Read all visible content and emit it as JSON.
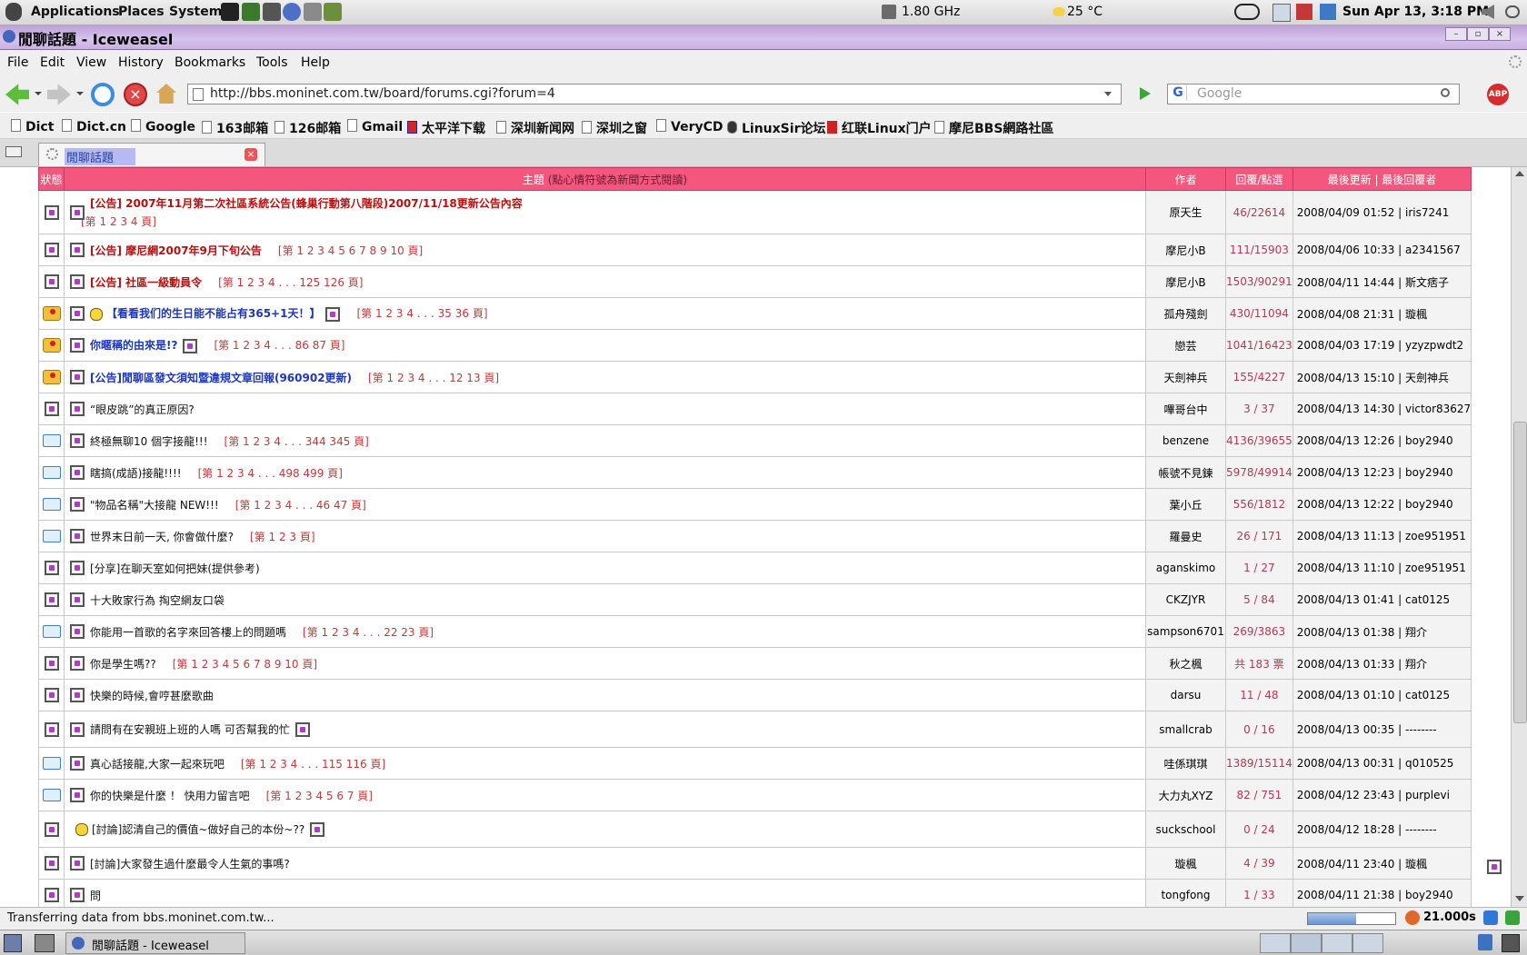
{
  "top_panel": {
    "menus": [
      "Applications",
      "Places",
      "System"
    ],
    "cpu": "1.80 GHz",
    "weather": "25 °C",
    "clock": "Sun Apr 13,  3:18 PM"
  },
  "window": {
    "title": "閒聊話題 - Iceweasel"
  },
  "menubar": [
    "File",
    "Edit",
    "View",
    "History",
    "Bookmarks",
    "Tools",
    "Help"
  ],
  "navbar": {
    "url": "http://bbs.moninet.com.tw/board/forums.cgi?forum=4",
    "search_placeholder": "Google",
    "search_engine_letter": "G",
    "adblock": "ABP"
  },
  "bookmarks": [
    "Dict",
    "Dict.cn",
    "Google",
    "163邮箱",
    "126邮箱",
    "Gmail",
    "太平洋下载",
    "深圳新闻网",
    "深圳之窗",
    "VeryCD",
    "LinuxSir论坛",
    "红联Linux门户",
    "摩尼BBS網路社區"
  ],
  "tab": {
    "label": "閒聊話題"
  },
  "table": {
    "headers": {
      "status": "狀態",
      "topic": "主題",
      "topic_note": "(點心情符號為新聞方式閱讀)",
      "author": "作者",
      "replies": "回覆/點選",
      "last": "最後更新 | 最後回覆者"
    },
    "rows": [
      {
        "status": "normal",
        "title": "[公告] 2007年11月第二次社區系統公告(蜂巢行動第八階段)2007/11/18更新公告內容",
        "style": "red",
        "pages": "[第 1 2 3 4 頁]",
        "pages_wrap": true,
        "author": "原天生",
        "replies": "46/22614",
        "last": "2008/04/09 01:52 | iris7241"
      },
      {
        "status": "normal",
        "title": "[公告] 摩尼網2007年9月下旬公告",
        "style": "red",
        "pages": "[第 1 2 3 4 5 6 7 8 9 10 頁]",
        "author": "摩尼小B",
        "replies": "111/15903",
        "last": "2008/04/06 10:33 | a2341567"
      },
      {
        "status": "normal",
        "title": "[公告] 社區一級動員令",
        "style": "red",
        "pages": "[第 1 2 3 4 . . . 125 126 頁]",
        "author": "摩尼小B",
        "replies": "1503/90291",
        "last": "2008/04/11 14:44 | 斯文痞子"
      },
      {
        "status": "hot",
        "title": "【看看我们的生日能不能占有365+1天！】",
        "style": "blue",
        "smiley": true,
        "trail_icon": true,
        "pages": "[第 1 2 3 4 . . . 35 36 頁]",
        "author": "孤舟殘劍",
        "replies": "430/11094",
        "last": "2008/04/08 21:31 | 璇楓"
      },
      {
        "status": "hot",
        "title": "你暱稱的由來是!?",
        "style": "blue",
        "trail_icon": true,
        "pages": "[第 1 2 3 4 . . . 86 87 頁]",
        "author": "戀芸",
        "replies": "1041/16423",
        "last": "2008/04/03 17:19 | yzyzpwdt2"
      },
      {
        "status": "hot",
        "title": "[公告]閒聊區發文須知暨違規文章回報(960902更新)",
        "style": "blue",
        "pages": "[第 1 2 3 4 . . . 12 13 頁]",
        "author": "天劍神兵",
        "replies": "155/4227",
        "last": "2008/04/13 15:10 | 天劍神兵"
      },
      {
        "status": "normal",
        "title": "“眼皮跳”的真正原因?",
        "style": "plain",
        "pages": "",
        "author": "嗶哥台中",
        "replies": "3 / 37",
        "last": "2008/04/13 14:30 | victor83627"
      },
      {
        "status": "new",
        "title": "終極無聊10 個字接龍!!!",
        "style": "plain",
        "pages": "[第 1 2 3 4 . . . 344 345 頁]",
        "author": "benzene",
        "replies": "4136/39655",
        "last": "2008/04/13 12:26 | boy2940"
      },
      {
        "status": "new",
        "title": "瞎搞(成語)接龍!!!!",
        "style": "plain",
        "pages": "[第 1 2 3 4 . . . 498 499 頁]",
        "author": "帳號不見鍊",
        "replies": "5978/49914",
        "last": "2008/04/13 12:23 | boy2940"
      },
      {
        "status": "new",
        "title": "\"物品名稱\"大接龍 NEW!!!",
        "style": "plain",
        "pages": "[第 1 2 3 4 . . . 46 47 頁]",
        "author": "葉小丘",
        "replies": "556/1812",
        "last": "2008/04/13 12:22 | boy2940"
      },
      {
        "status": "new",
        "title": "世界末日前一天, 你會做什麼?",
        "style": "plain",
        "pages": "[第 1 2 3 頁]",
        "author": "羅曼史",
        "replies": "26 / 171",
        "last": "2008/04/13 11:13 | zoe951951"
      },
      {
        "status": "normal",
        "title": "[分享]在聊天室如何把妹(提供參考)",
        "style": "plain",
        "pages": "",
        "author": "aganskimo",
        "replies": "1 / 27",
        "last": "2008/04/13 11:10 | zoe951951"
      },
      {
        "status": "normal",
        "title": "十大敗家行為 掏空網友口袋",
        "style": "plain",
        "pages": "",
        "author": "CKZJYR",
        "replies": "5 / 84",
        "last": "2008/04/13 01:41 | cat0125"
      },
      {
        "status": "new",
        "title": "你能用一首歌的名字來回答樓上的問題嗎",
        "style": "plain",
        "pages": "[第 1 2 3 4 . . . 22 23 頁]",
        "author": "sampson6701",
        "replies": "269/3863",
        "last": "2008/04/13 01:38 | 翔介"
      },
      {
        "status": "normal",
        "title": "你是學生嗎??",
        "style": "plain",
        "pages": "[第 1 2 3 4 5 6 7 8 9 10 頁]",
        "author": "秋之楓",
        "replies": "共 183 票",
        "last": "2008/04/13 01:33 | 翔介"
      },
      {
        "status": "normal",
        "title": "快樂的時候,會哼甚麼歌曲",
        "style": "plain",
        "pages": "",
        "author": "darsu",
        "replies": "11 / 48",
        "last": "2008/04/13 01:10 | cat0125"
      },
      {
        "status": "normal",
        "title": "請問有在安親班上班的人嗎   可否幫我的忙",
        "style": "plain",
        "trail_icon": true,
        "pages": "",
        "author": "smallcrab",
        "replies": "0 / 16",
        "last": "2008/04/13 00:35 | --------"
      },
      {
        "status": "new",
        "title": "真心話接龍,大家一起來玩吧",
        "style": "plain",
        "pages": "[第 1 2 3 4 . . . 115 116 頁]",
        "author": "哇係琪琪",
        "replies": "1389/15114",
        "last": "2008/04/13 00:31 | q010525"
      },
      {
        "status": "new",
        "title": "你的快樂是什麼 ！ 快用力留言吧",
        "style": "plain",
        "pages": "[第 1 2 3 4 5 6 7 頁]",
        "author": "大力丸XYZ",
        "replies": "82 / 751",
        "last": "2008/04/12 23:43 | purplevi"
      },
      {
        "status": "normal",
        "title": "[討論]認清自己的價值~做好自己的本份~??",
        "style": "plain",
        "smiley": true,
        "no_lead_icon": true,
        "trail_icon": true,
        "pages": "",
        "author": "suckschool",
        "replies": "0 / 24",
        "last": "2008/04/12 18:28 | --------"
      },
      {
        "status": "normal",
        "title": "[討論]大家發生過什麼最令人生氣的事嗎?",
        "style": "plain",
        "pages": "",
        "author": "璇楓",
        "replies": "4 / 39",
        "last": "2008/04/11 23:40 | 璇楓"
      },
      {
        "status": "normal",
        "title": "問",
        "style": "plain",
        "pages": "",
        "author": "tongfong",
        "replies": "1 / 33",
        "last": "2008/04/11 21:38 | boy2940"
      }
    ]
  },
  "status": {
    "text": "Transferring data from bbs.moninet.com.tw...",
    "progress": 0.55,
    "load_time": "21.000s"
  },
  "taskbar": {
    "window_label": "閒聊話題 - Iceweasel"
  }
}
